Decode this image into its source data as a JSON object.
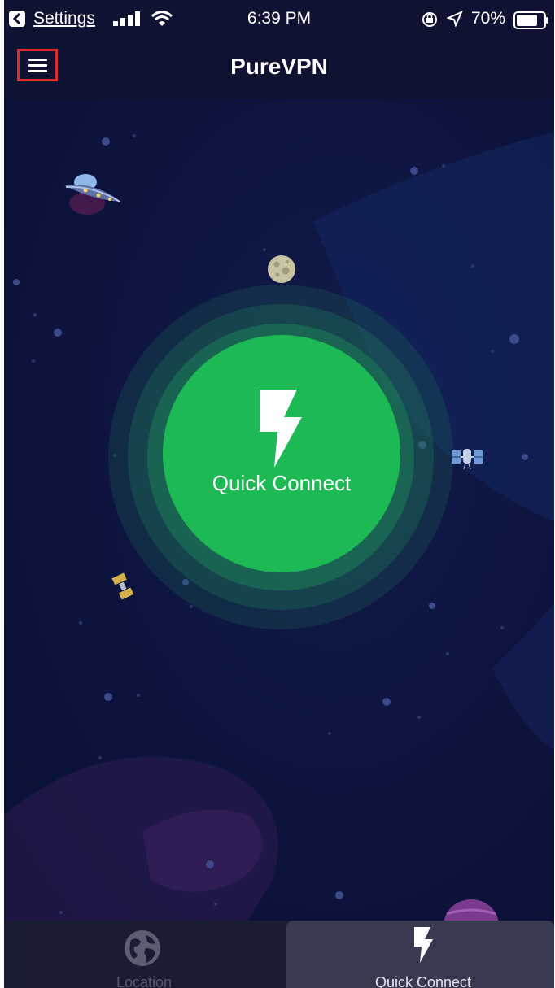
{
  "status_bar": {
    "back_app": "Settings",
    "time": "6:39 PM",
    "battery_pct": "70%"
  },
  "nav": {
    "title": "PureVPN",
    "menu_icon": "hamburger-menu-icon"
  },
  "main": {
    "quick_connect_label": "Quick Connect",
    "quick_connect_icon": "lightning-bolt-icon"
  },
  "tabs": [
    {
      "label": "Location",
      "icon": "globe-icon",
      "selected": false
    },
    {
      "label": "Quick Connect",
      "icon": "lightning-bolt-icon",
      "selected": true
    }
  ],
  "colors": {
    "background": "#0b1238",
    "bar": "#0f1230",
    "accent_green": "#1db954",
    "menu_highlight": "#e22a2a",
    "tab_bar": "#1a1c36",
    "tab_selected": "#383a52"
  }
}
